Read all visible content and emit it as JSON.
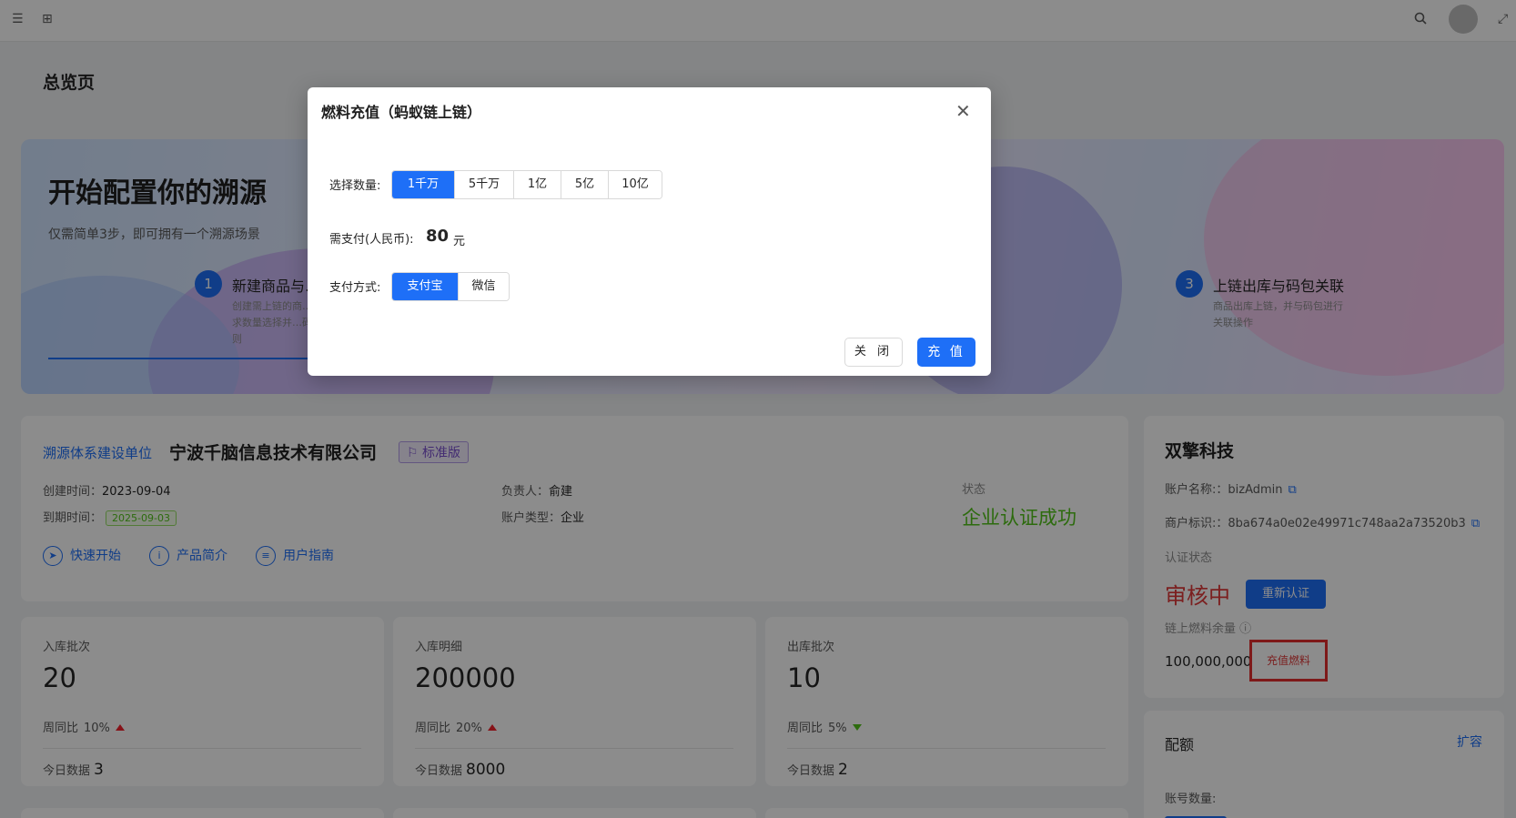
{
  "page": {
    "title": "总览页"
  },
  "banner": {
    "title": "开始配置你的溯源",
    "subtitle": "仅需简单3步，即可拥有一个溯源场景",
    "steps": [
      {
        "num": "1",
        "title": "新建商品与…",
        "desc": "创建需上链的商…需求数量选择并…码规则"
      },
      {
        "num": "3",
        "title": "上链出库与码包关联",
        "desc": "商品出库上链，并与码包进行关联操作"
      }
    ]
  },
  "org": {
    "label": "溯源体系建设单位",
    "name": "宁波千脑信息技术有限公司",
    "edition": "标准版",
    "created_label": "创建时间：",
    "created_value": "2023-09-04",
    "expire_label": "到期时间：",
    "expire_value": "2025-09-03",
    "owner_label": "负责人：",
    "owner_value": "俞建",
    "type_label": "账户类型：",
    "type_value": "企业",
    "status_label": "状态",
    "status_value": "企业认证成功",
    "links": [
      "快速开始",
      "产品简介",
      "用户指南"
    ]
  },
  "stats": [
    {
      "label": "入库批次",
      "value": "20",
      "wow_label": "周同比",
      "wow_pct": "10%",
      "trend": "up",
      "today_label": "今日数据",
      "today_value": "3"
    },
    {
      "label": "入库明细",
      "value": "200000",
      "wow_label": "周同比",
      "wow_pct": "20%",
      "trend": "up",
      "today_label": "今日数据",
      "today_value": "8000"
    },
    {
      "label": "出库批次",
      "value": "10",
      "wow_label": "周同比",
      "wow_pct": "5%",
      "trend": "down",
      "today_label": "今日数据",
      "today_value": "2"
    }
  ],
  "account": {
    "title": "双擎科技",
    "name_label": "账户名称:：",
    "name_value": "bizAdmin",
    "merchant_label": "商户标识:：",
    "merchant_value": "8ba674a0e02e49971c748aa2a73520b3",
    "cert_label": "认证状态",
    "cert_value": "审核中",
    "recert_button": "重新认证",
    "fuel_label": "链上燃料余量",
    "fuel_value": "100,000,000",
    "recharge_fuel": "充值燃料"
  },
  "quota": {
    "title": "配额",
    "expand": "扩容",
    "accounts_label": "账号数量:"
  },
  "modal": {
    "title": "燃料充值（蚂蚁链上链）",
    "qty_label": "选择数量:",
    "qty_options": [
      "1千万",
      "5千万",
      "1亿",
      "5亿",
      "10亿"
    ],
    "qty_selected": "1千万",
    "pay_label": "需支付(人民币):",
    "pay_amount": "80",
    "pay_unit": "元",
    "method_label": "支付方式:",
    "method_options": [
      "支付宝",
      "微信"
    ],
    "method_selected": "支付宝",
    "close_button": "关 闭",
    "charge_button": "充 值"
  },
  "colors": {
    "primary": "#1e6ff7",
    "success": "#52c41a",
    "danger": "#e03a3a"
  }
}
